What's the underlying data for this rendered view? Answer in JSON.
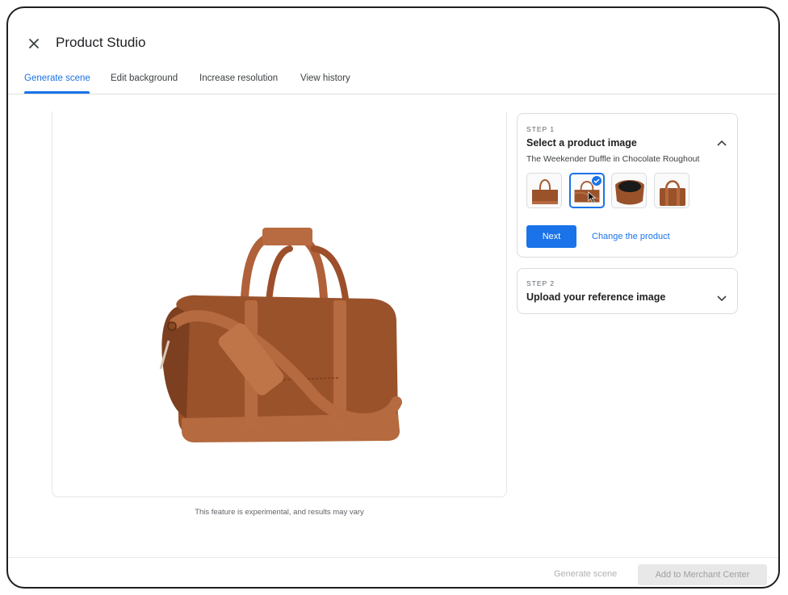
{
  "header": {
    "title": "Product Studio"
  },
  "tabs": [
    {
      "label": "Generate scene"
    },
    {
      "label": "Edit background"
    },
    {
      "label": "Increase resolution"
    },
    {
      "label": "View history"
    }
  ],
  "canvas": {
    "disclaimer": "This feature is experimental, and results may vary"
  },
  "step1": {
    "label": "STEP 1",
    "title": "Select a product image",
    "product_name": "The Weekender Duffle in Chocolate Roughout",
    "next_label": "Next",
    "change_label": "Change the product"
  },
  "step2": {
    "label": "STEP 2",
    "title": "Upload your reference image"
  },
  "footer": {
    "generate_label": "Generate scene",
    "add_label": "Add to Merchant Center"
  },
  "colors": {
    "accent": "#1a73e8",
    "leather": "#a0552d",
    "strap": "#b5653a",
    "disabled_bg": "#e8e8e8",
    "disabled_text": "#9e9e9e"
  }
}
